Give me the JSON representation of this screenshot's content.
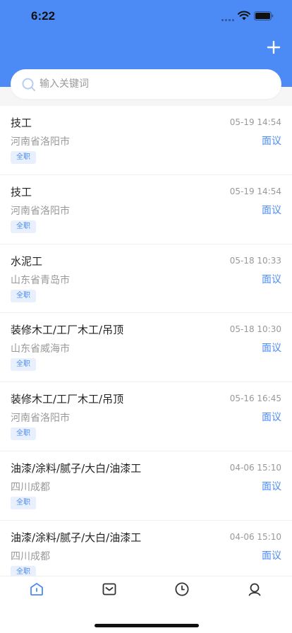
{
  "status_bar": {
    "time": "6:22"
  },
  "header": {
    "add_icon": "plus-icon",
    "accent_color": "#4c8bf5"
  },
  "search": {
    "placeholder": "输入关键词",
    "value": ""
  },
  "jobs": [
    {
      "title": "技工",
      "date": "05-19 14:54",
      "location": "河南省洛阳市",
      "salary": "面议",
      "tag": "全职"
    },
    {
      "title": "技工",
      "date": "05-19 14:54",
      "location": "河南省洛阳市",
      "salary": "面议",
      "tag": "全职"
    },
    {
      "title": "水泥工",
      "date": "05-18 10:33",
      "location": "山东省青岛市",
      "salary": "面议",
      "tag": "全职"
    },
    {
      "title": "装修木工/工厂木工/吊顶",
      "date": "05-18 10:30",
      "location": "山东省威海市",
      "salary": "面议",
      "tag": "全职"
    },
    {
      "title": "装修木工/工厂木工/吊顶",
      "date": "05-16 16:45",
      "location": "河南省洛阳市",
      "salary": "面议",
      "tag": "全职"
    },
    {
      "title": "油漆/涂料/腻子/大白/油漆工",
      "date": "04-06 15:10",
      "location": "四川成都",
      "salary": "面议",
      "tag": "全职"
    },
    {
      "title": "油漆/涂料/腻子/大白/油漆工",
      "date": "04-06 15:10",
      "location": "四川成都",
      "salary": "面议",
      "tag": "全职"
    }
  ],
  "tabbar": {
    "tabs": [
      {
        "icon": "home-icon",
        "active": true
      },
      {
        "icon": "message-icon",
        "active": false
      },
      {
        "icon": "clock-icon",
        "active": false
      },
      {
        "icon": "profile-icon",
        "active": false
      }
    ],
    "active_color": "#4c8bf5",
    "inactive_color": "#333333"
  }
}
